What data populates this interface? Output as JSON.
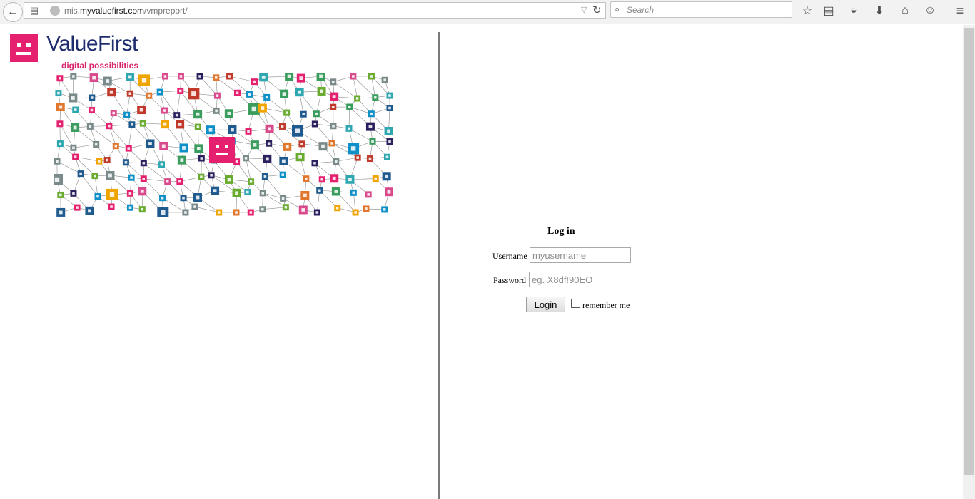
{
  "browser": {
    "url_prefix": "mis.",
    "url_host": "myvaluefirst.com",
    "url_path": "/vmpreport/",
    "search_placeholder": "Search"
  },
  "logo": {
    "name": "ValueFirst",
    "tagline": "digital possibilities",
    "brand_color": "#e5206f",
    "text_color": "#1f2d6e"
  },
  "login": {
    "title": "Log in",
    "username_label": "Username",
    "username_placeholder": "myusername",
    "password_label": "Password",
    "password_placeholder": "eg. X8df!90EO",
    "button_label": "Login",
    "remember_label": "remember me"
  },
  "icons": {
    "back": "back-arrow-icon",
    "reload": "reload-icon",
    "bookmark": "star-icon",
    "reading_list": "clipboard-icon",
    "pocket": "pocket-icon",
    "download": "download-icon",
    "home": "home-icon",
    "hello": "chat-icon",
    "menu": "hamburger-menu-icon"
  },
  "graphic_colors": [
    "#e5206f",
    "#0d8fc7",
    "#1e5a8e",
    "#68ab2e",
    "#f0a400",
    "#e0772c",
    "#c0392b",
    "#2c1f5e",
    "#7a8a8a",
    "#3a9d5d",
    "#d94a8c",
    "#2ea7b0"
  ]
}
